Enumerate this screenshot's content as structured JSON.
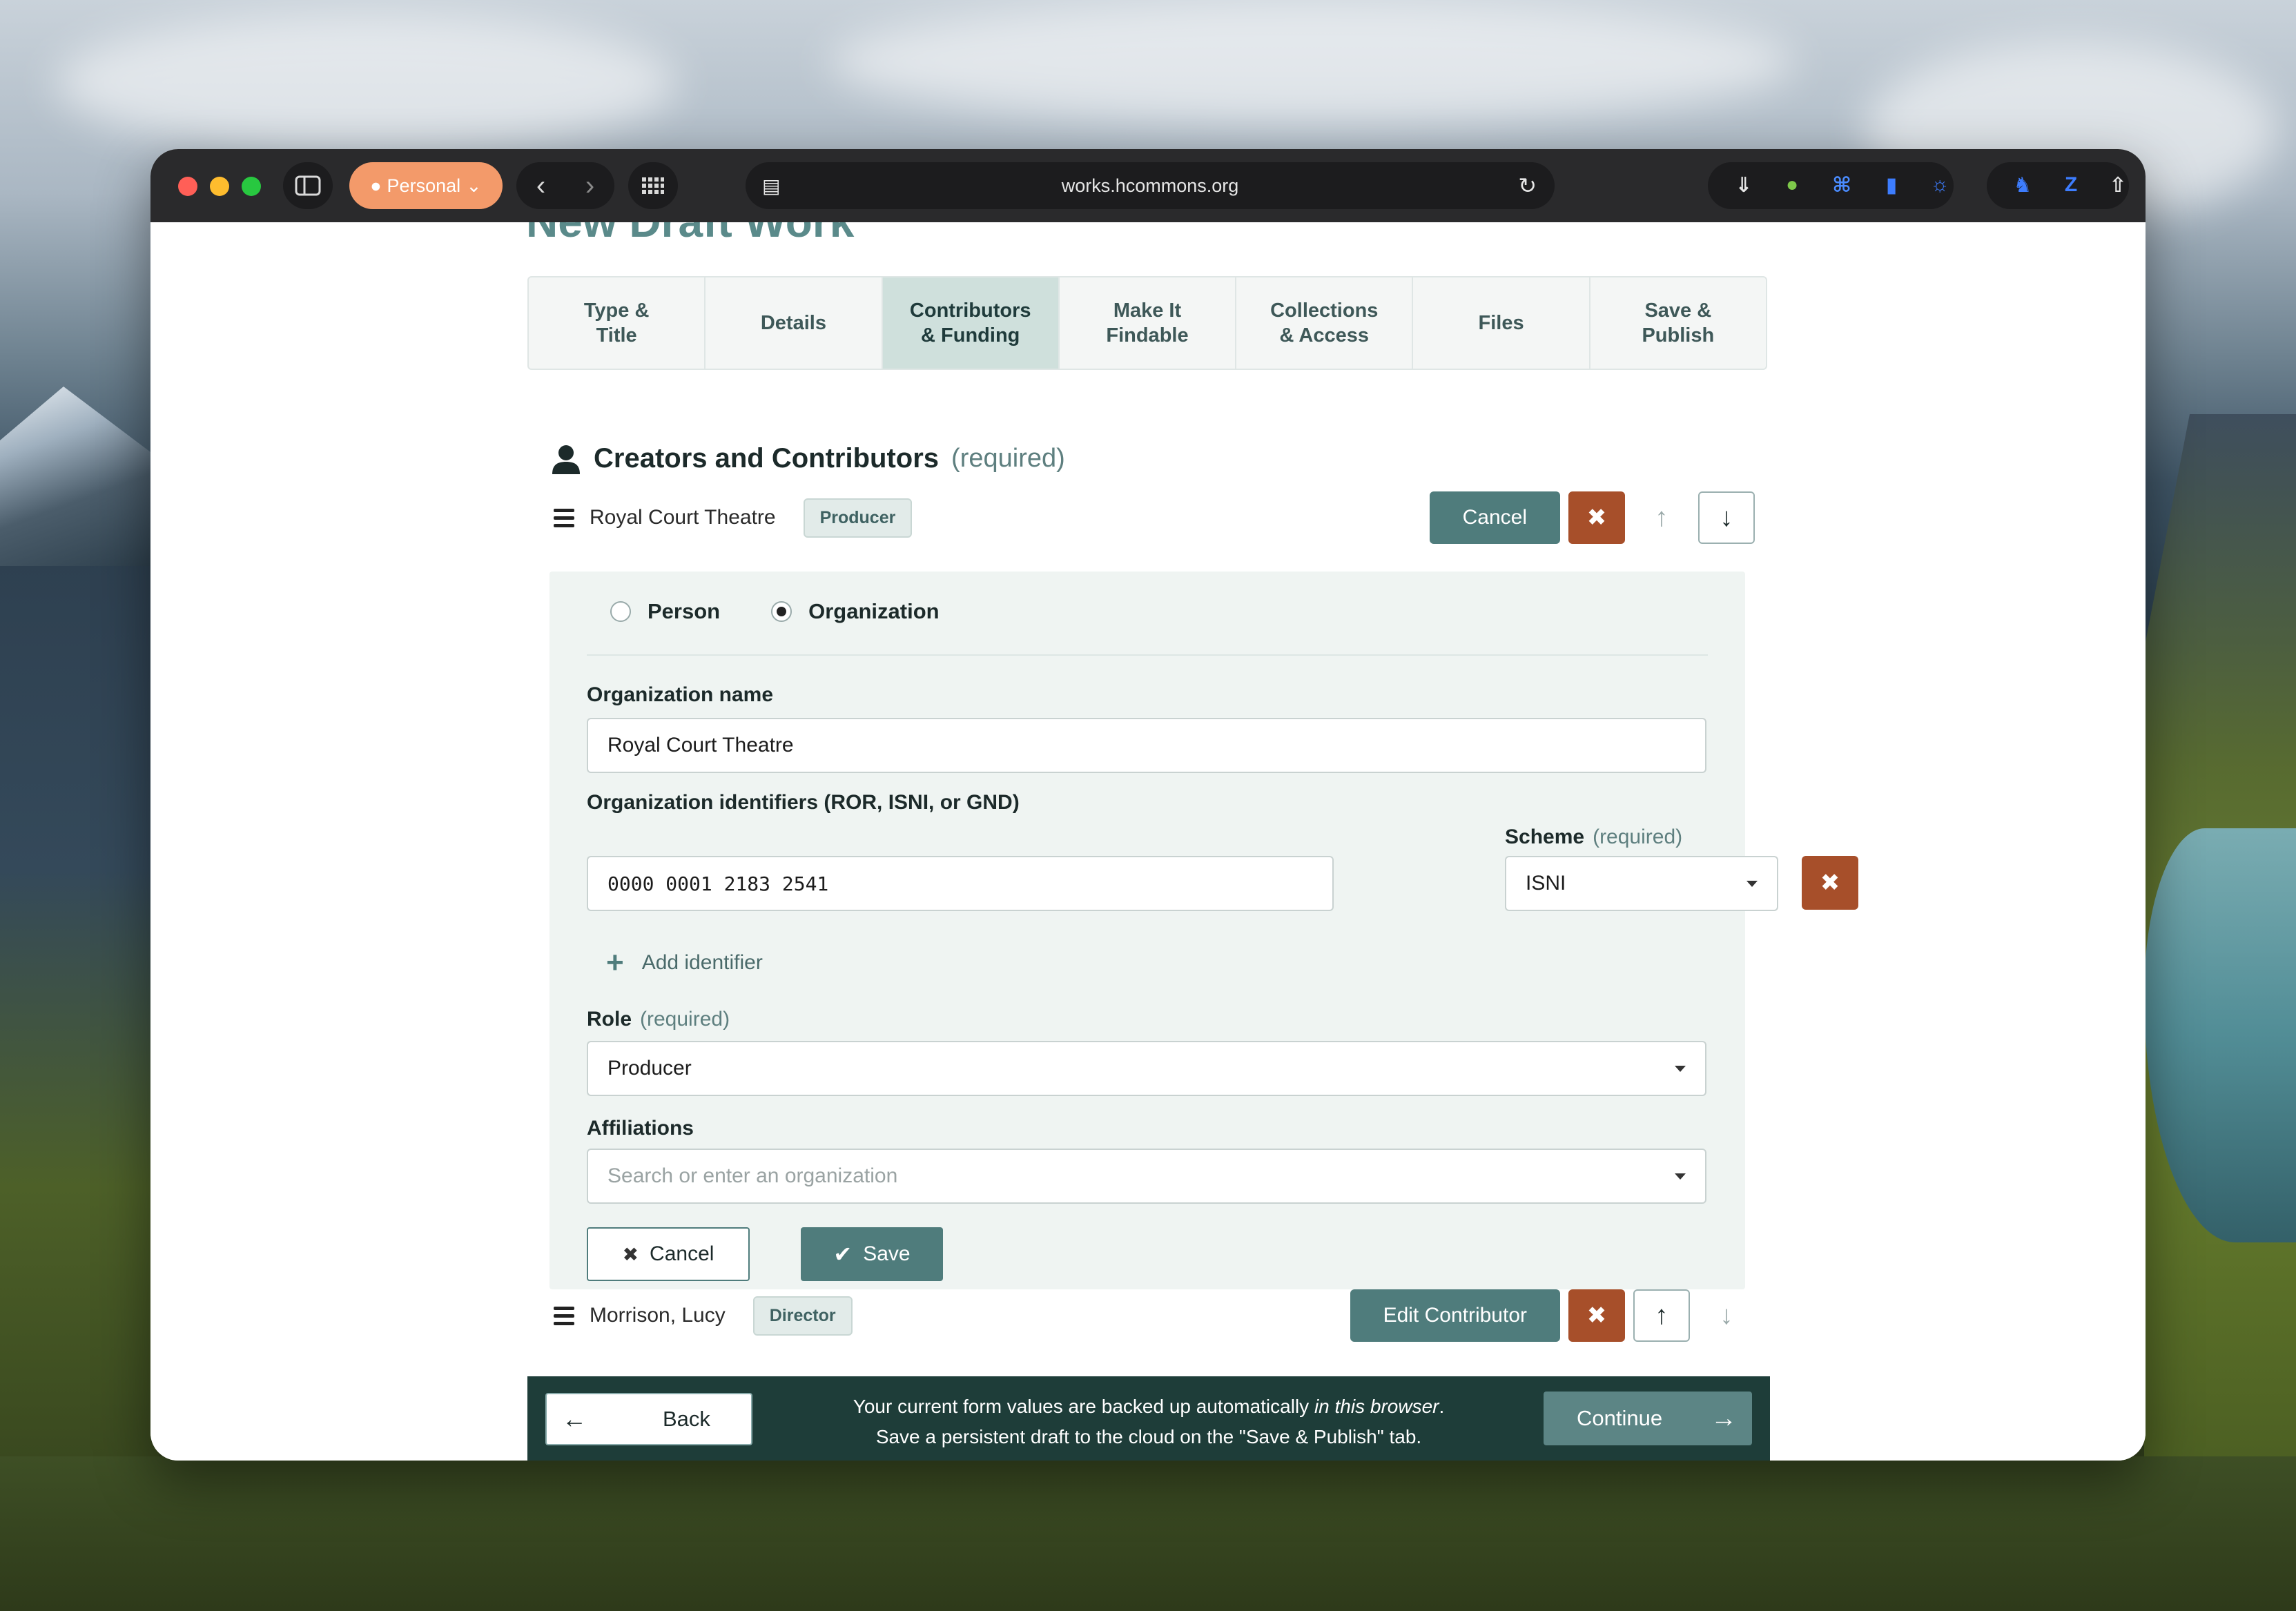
{
  "browser": {
    "profile_label": "Personal",
    "url": "works.hcommons.org"
  },
  "page": {
    "title": "New Draft Work"
  },
  "steps": [
    {
      "label": "Type &\nTitle",
      "active": false
    },
    {
      "label": "Details",
      "active": false
    },
    {
      "label": "Contributors\n& Funding",
      "active": true
    },
    {
      "label": "Make It\nFindable",
      "active": false
    },
    {
      "label": "Collections\n& Access",
      "active": false
    },
    {
      "label": "Files",
      "active": false
    },
    {
      "label": "Save &\nPublish",
      "active": false
    }
  ],
  "section": {
    "title": "Creators and Contributors",
    "required": "(required)"
  },
  "contributors": [
    {
      "name": "Royal Court Theatre",
      "role": "Producer",
      "action_label": "Cancel"
    },
    {
      "name": "Morrison, Lucy",
      "role": "Director",
      "action_label": "Edit Contributor"
    }
  ],
  "form": {
    "type_person": "Person",
    "type_organization": "Organization",
    "org_name_label": "Organization name",
    "org_name_value": "Royal Court Theatre",
    "identifiers_label": "Organization identifiers (ROR, ISNI, or GND)",
    "identifier_value": "0000 0001 2183 2541",
    "scheme_label": "Scheme",
    "scheme_required": "(required)",
    "scheme_value": "ISNI",
    "add_identifier": "Add identifier",
    "role_label": "Role",
    "role_required": "(required)",
    "role_value": "Producer",
    "affiliations_label": "Affiliations",
    "affiliations_placeholder": "Search or enter an organization",
    "cancel_label": "Cancel",
    "save_label": "Save"
  },
  "footer": {
    "back_label": "Back",
    "message_line1": "Your current form values are backed up automatically ",
    "message_emph": "in this browser",
    "message_line1_end": ".",
    "message_line2": "Save a persistent draft to the cloud on the \"Save & Publish\" tab.",
    "continue_label": "Continue"
  },
  "colors": {
    "accent": "#4f7c7c",
    "delete": "#a74f2a",
    "footer_bg": "#1e3d39",
    "profile": "#f39a6a"
  }
}
